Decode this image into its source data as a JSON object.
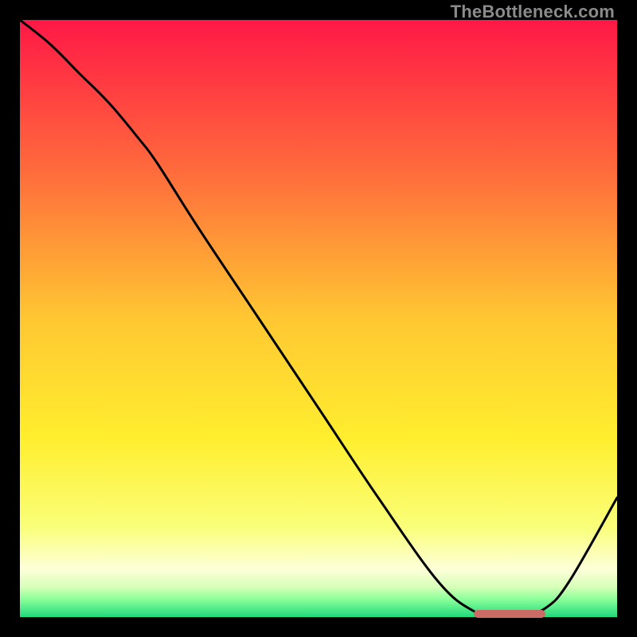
{
  "watermark": "TheBottleneck.com",
  "chart_data": {
    "type": "line",
    "title": "",
    "xlabel": "",
    "ylabel": "",
    "xlim": [
      0,
      100
    ],
    "ylim": [
      0,
      100
    ],
    "series": [
      {
        "name": "curve",
        "x": [
          0,
          5,
          10,
          15,
          20,
          23,
          30,
          40,
          50,
          60,
          70,
          76,
          80,
          84,
          88,
          92,
          100
        ],
        "y": [
          100,
          96,
          91,
          86,
          80,
          76,
          65,
          50,
          35,
          20,
          6,
          1,
          0.3,
          0.3,
          1.5,
          6,
          20
        ]
      }
    ],
    "marker": {
      "x_start": 76,
      "x_end": 88,
      "y": 0.5
    },
    "gradient_stops": [
      {
        "pos": 0,
        "color": "#ff1846"
      },
      {
        "pos": 25,
        "color": "#ff6a3c"
      },
      {
        "pos": 50,
        "color": "#ffc732"
      },
      {
        "pos": 70,
        "color": "#ffee2e"
      },
      {
        "pos": 85,
        "color": "#faff7a"
      },
      {
        "pos": 92,
        "color": "#fdffd8"
      },
      {
        "pos": 95,
        "color": "#d6ffb8"
      },
      {
        "pos": 97,
        "color": "#8bff9a"
      },
      {
        "pos": 100,
        "color": "#1fd97a"
      }
    ]
  }
}
